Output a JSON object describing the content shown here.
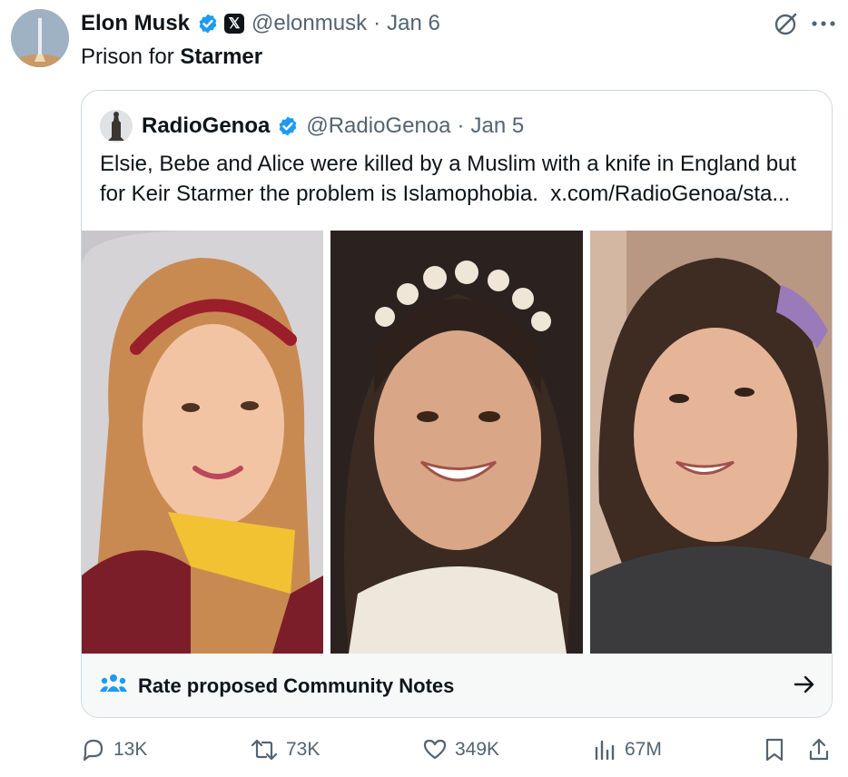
{
  "tweet": {
    "author": {
      "name": "Elon Musk",
      "handle": "@elonmusk",
      "date": "Jan 6"
    },
    "badge_icon": "x-logo-icon",
    "text_prefix": "Prison for ",
    "text_bold": "Starmer"
  },
  "quoted": {
    "author": {
      "name": "RadioGenoa",
      "handle": "@RadioGenoa",
      "date": "Jan 5"
    },
    "text": "Elsie, Bebe and Alice were killed by a Muslim with a knife in England but for Keir Starmer the problem is Islamophobia.",
    "link": "x.com/RadioGenoa/sta..."
  },
  "community_notes": {
    "label": "Rate proposed Community Notes",
    "icon": "people-icon"
  },
  "actions": {
    "replies": "13K",
    "reposts": "73K",
    "likes": "349K",
    "views": "67M"
  },
  "separator": "·",
  "colors": {
    "verified": "#1d9bf0",
    "muted": "#536471",
    "border": "#cfd9de",
    "notes_bg": "#f7f9f9"
  }
}
